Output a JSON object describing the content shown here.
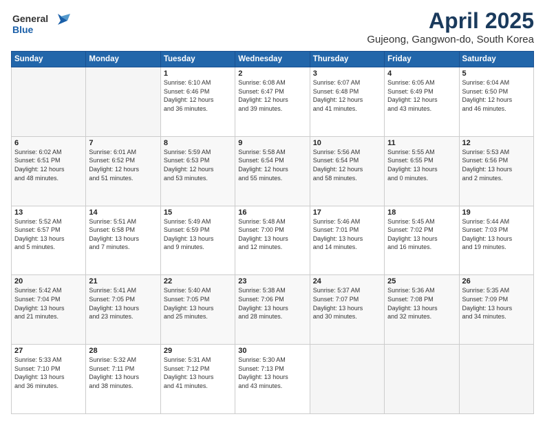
{
  "header": {
    "logo_line1": "General",
    "logo_line2": "Blue",
    "title": "April 2025",
    "subtitle": "Gujeong, Gangwon-do, South Korea"
  },
  "weekdays": [
    "Sunday",
    "Monday",
    "Tuesday",
    "Wednesday",
    "Thursday",
    "Friday",
    "Saturday"
  ],
  "weeks": [
    [
      {
        "day": "",
        "empty": true
      },
      {
        "day": "",
        "empty": true
      },
      {
        "day": "1",
        "detail": "Sunrise: 6:10 AM\nSunset: 6:46 PM\nDaylight: 12 hours\nand 36 minutes."
      },
      {
        "day": "2",
        "detail": "Sunrise: 6:08 AM\nSunset: 6:47 PM\nDaylight: 12 hours\nand 39 minutes."
      },
      {
        "day": "3",
        "detail": "Sunrise: 6:07 AM\nSunset: 6:48 PM\nDaylight: 12 hours\nand 41 minutes."
      },
      {
        "day": "4",
        "detail": "Sunrise: 6:05 AM\nSunset: 6:49 PM\nDaylight: 12 hours\nand 43 minutes."
      },
      {
        "day": "5",
        "detail": "Sunrise: 6:04 AM\nSunset: 6:50 PM\nDaylight: 12 hours\nand 46 minutes."
      }
    ],
    [
      {
        "day": "6",
        "detail": "Sunrise: 6:02 AM\nSunset: 6:51 PM\nDaylight: 12 hours\nand 48 minutes."
      },
      {
        "day": "7",
        "detail": "Sunrise: 6:01 AM\nSunset: 6:52 PM\nDaylight: 12 hours\nand 51 minutes."
      },
      {
        "day": "8",
        "detail": "Sunrise: 5:59 AM\nSunset: 6:53 PM\nDaylight: 12 hours\nand 53 minutes."
      },
      {
        "day": "9",
        "detail": "Sunrise: 5:58 AM\nSunset: 6:54 PM\nDaylight: 12 hours\nand 55 minutes."
      },
      {
        "day": "10",
        "detail": "Sunrise: 5:56 AM\nSunset: 6:54 PM\nDaylight: 12 hours\nand 58 minutes."
      },
      {
        "day": "11",
        "detail": "Sunrise: 5:55 AM\nSunset: 6:55 PM\nDaylight: 13 hours\nand 0 minutes."
      },
      {
        "day": "12",
        "detail": "Sunrise: 5:53 AM\nSunset: 6:56 PM\nDaylight: 13 hours\nand 2 minutes."
      }
    ],
    [
      {
        "day": "13",
        "detail": "Sunrise: 5:52 AM\nSunset: 6:57 PM\nDaylight: 13 hours\nand 5 minutes."
      },
      {
        "day": "14",
        "detail": "Sunrise: 5:51 AM\nSunset: 6:58 PM\nDaylight: 13 hours\nand 7 minutes."
      },
      {
        "day": "15",
        "detail": "Sunrise: 5:49 AM\nSunset: 6:59 PM\nDaylight: 13 hours\nand 9 minutes."
      },
      {
        "day": "16",
        "detail": "Sunrise: 5:48 AM\nSunset: 7:00 PM\nDaylight: 13 hours\nand 12 minutes."
      },
      {
        "day": "17",
        "detail": "Sunrise: 5:46 AM\nSunset: 7:01 PM\nDaylight: 13 hours\nand 14 minutes."
      },
      {
        "day": "18",
        "detail": "Sunrise: 5:45 AM\nSunset: 7:02 PM\nDaylight: 13 hours\nand 16 minutes."
      },
      {
        "day": "19",
        "detail": "Sunrise: 5:44 AM\nSunset: 7:03 PM\nDaylight: 13 hours\nand 19 minutes."
      }
    ],
    [
      {
        "day": "20",
        "detail": "Sunrise: 5:42 AM\nSunset: 7:04 PM\nDaylight: 13 hours\nand 21 minutes."
      },
      {
        "day": "21",
        "detail": "Sunrise: 5:41 AM\nSunset: 7:05 PM\nDaylight: 13 hours\nand 23 minutes."
      },
      {
        "day": "22",
        "detail": "Sunrise: 5:40 AM\nSunset: 7:05 PM\nDaylight: 13 hours\nand 25 minutes."
      },
      {
        "day": "23",
        "detail": "Sunrise: 5:38 AM\nSunset: 7:06 PM\nDaylight: 13 hours\nand 28 minutes."
      },
      {
        "day": "24",
        "detail": "Sunrise: 5:37 AM\nSunset: 7:07 PM\nDaylight: 13 hours\nand 30 minutes."
      },
      {
        "day": "25",
        "detail": "Sunrise: 5:36 AM\nSunset: 7:08 PM\nDaylight: 13 hours\nand 32 minutes."
      },
      {
        "day": "26",
        "detail": "Sunrise: 5:35 AM\nSunset: 7:09 PM\nDaylight: 13 hours\nand 34 minutes."
      }
    ],
    [
      {
        "day": "27",
        "detail": "Sunrise: 5:33 AM\nSunset: 7:10 PM\nDaylight: 13 hours\nand 36 minutes."
      },
      {
        "day": "28",
        "detail": "Sunrise: 5:32 AM\nSunset: 7:11 PM\nDaylight: 13 hours\nand 38 minutes."
      },
      {
        "day": "29",
        "detail": "Sunrise: 5:31 AM\nSunset: 7:12 PM\nDaylight: 13 hours\nand 41 minutes."
      },
      {
        "day": "30",
        "detail": "Sunrise: 5:30 AM\nSunset: 7:13 PM\nDaylight: 13 hours\nand 43 minutes."
      },
      {
        "day": "",
        "empty": true
      },
      {
        "day": "",
        "empty": true
      },
      {
        "day": "",
        "empty": true
      }
    ]
  ],
  "colors": {
    "header_bg": "#2266aa",
    "title_color": "#1a3a5c"
  }
}
